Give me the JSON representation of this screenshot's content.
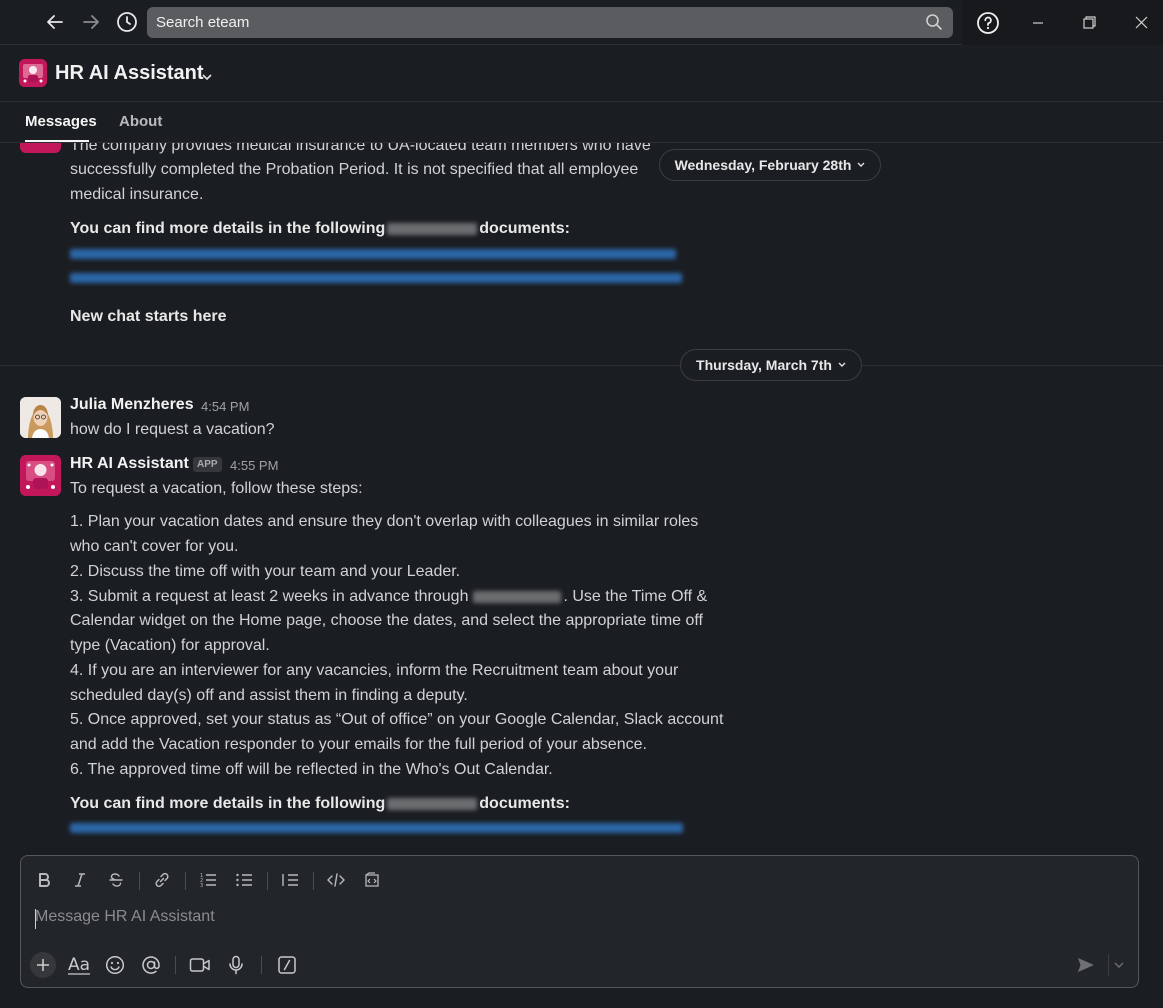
{
  "topbar": {
    "search_placeholder": "Search eteam",
    "icons": [
      "back-arrow-icon",
      "forward-arrow-icon",
      "history-icon",
      "search-icon",
      "help-icon",
      "minimize-icon",
      "restore-icon",
      "close-icon"
    ]
  },
  "channel": {
    "title": "HR AI Assistant",
    "tabs": [
      {
        "label": "Messages",
        "active": true
      },
      {
        "label": "About",
        "active": false
      }
    ]
  },
  "messages": {
    "earlier": {
      "line1": "The company provides medical insurance to UA-located team members who have",
      "line2": "successfully completed the Probation Period. It is not specified that all employee",
      "line3": "medical insurance.",
      "details_prefix": "You can find more details in the following",
      "details_suffix": "documents:",
      "new_chat": "New chat starts here"
    },
    "date_divider_1": "Wednesday, February 28th",
    "date_divider_2": "Thursday, March 7th",
    "user_msg": {
      "sender": "Julia Menzheres",
      "time": "4:54 PM",
      "text": "how do I request a vacation?"
    },
    "bot_msg": {
      "sender": "HR AI Assistant",
      "badge": "APP",
      "time": "4:55 PM",
      "intro": "To request a vacation, follow these steps:",
      "lines": [
        "1. Plan your vacation dates and ensure they don't overlap with colleagues in similar roles",
        "who can't cover for you.",
        "2. Discuss the time off with your team and your Leader.",
        "3. Submit a request at least 2 weeks in advance through",
        ". Use the Time Off &",
        "Calendar widget on the Home page, choose the dates, and select the appropriate time off",
        "type (Vacation) for approval.",
        "4. If you are an interviewer for any vacancies, inform the Recruitment team about your",
        "scheduled day(s) off and assist them in finding a deputy.",
        "5. Once approved, set your status as “Out of office” on your Google Calendar, Slack account",
        "and add the Vacation responder to your emails for the full period of your absence.",
        "6. The approved time off will be reflected in the Who's Out Calendar."
      ],
      "details_prefix": "You can find more details in the following",
      "details_suffix": "documents:"
    }
  },
  "composer": {
    "placeholder": "Message HR AI Assistant",
    "format_icons": [
      "bold-icon",
      "italic-icon",
      "strikethrough-icon",
      "link-icon",
      "ordered-list-icon",
      "bullet-list-icon",
      "blockquote-icon",
      "code-icon",
      "code-block-icon"
    ],
    "bottom_icons": [
      "plus-icon",
      "formatting-icon",
      "emoji-icon",
      "mention-icon",
      "video-icon",
      "microphone-icon",
      "slash-command-icon",
      "send-icon",
      "send-options-chevron-icon"
    ]
  }
}
